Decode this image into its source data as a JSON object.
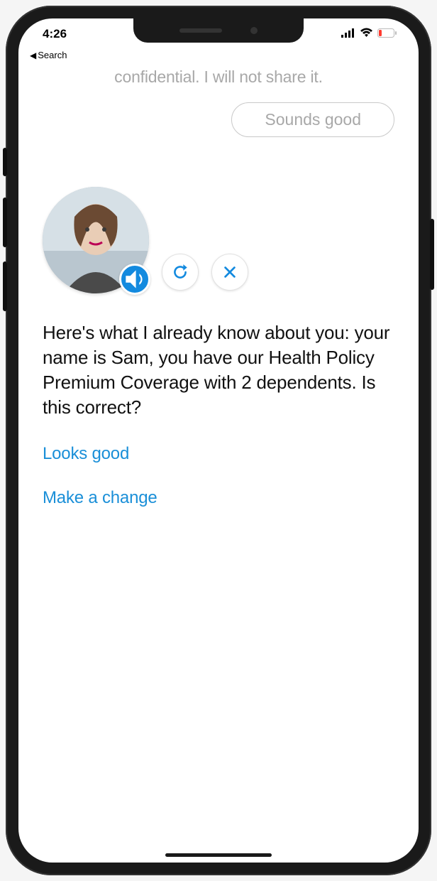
{
  "status": {
    "time": "4:26",
    "back_label": "Search"
  },
  "chat": {
    "previous_fragment": "confidential. I will not share it.",
    "user_reply": "Sounds good"
  },
  "controls": {
    "speaker_icon": "speaker-icon",
    "replay_icon": "replay-icon",
    "close_icon": "close-icon"
  },
  "bot": {
    "message": "Here's what I already know about you: your name is Sam, you have our Health Policy Premium Coverage with 2 dependents. Is this correct?",
    "option_confirm": "Looks good",
    "option_change": "Make a change"
  }
}
